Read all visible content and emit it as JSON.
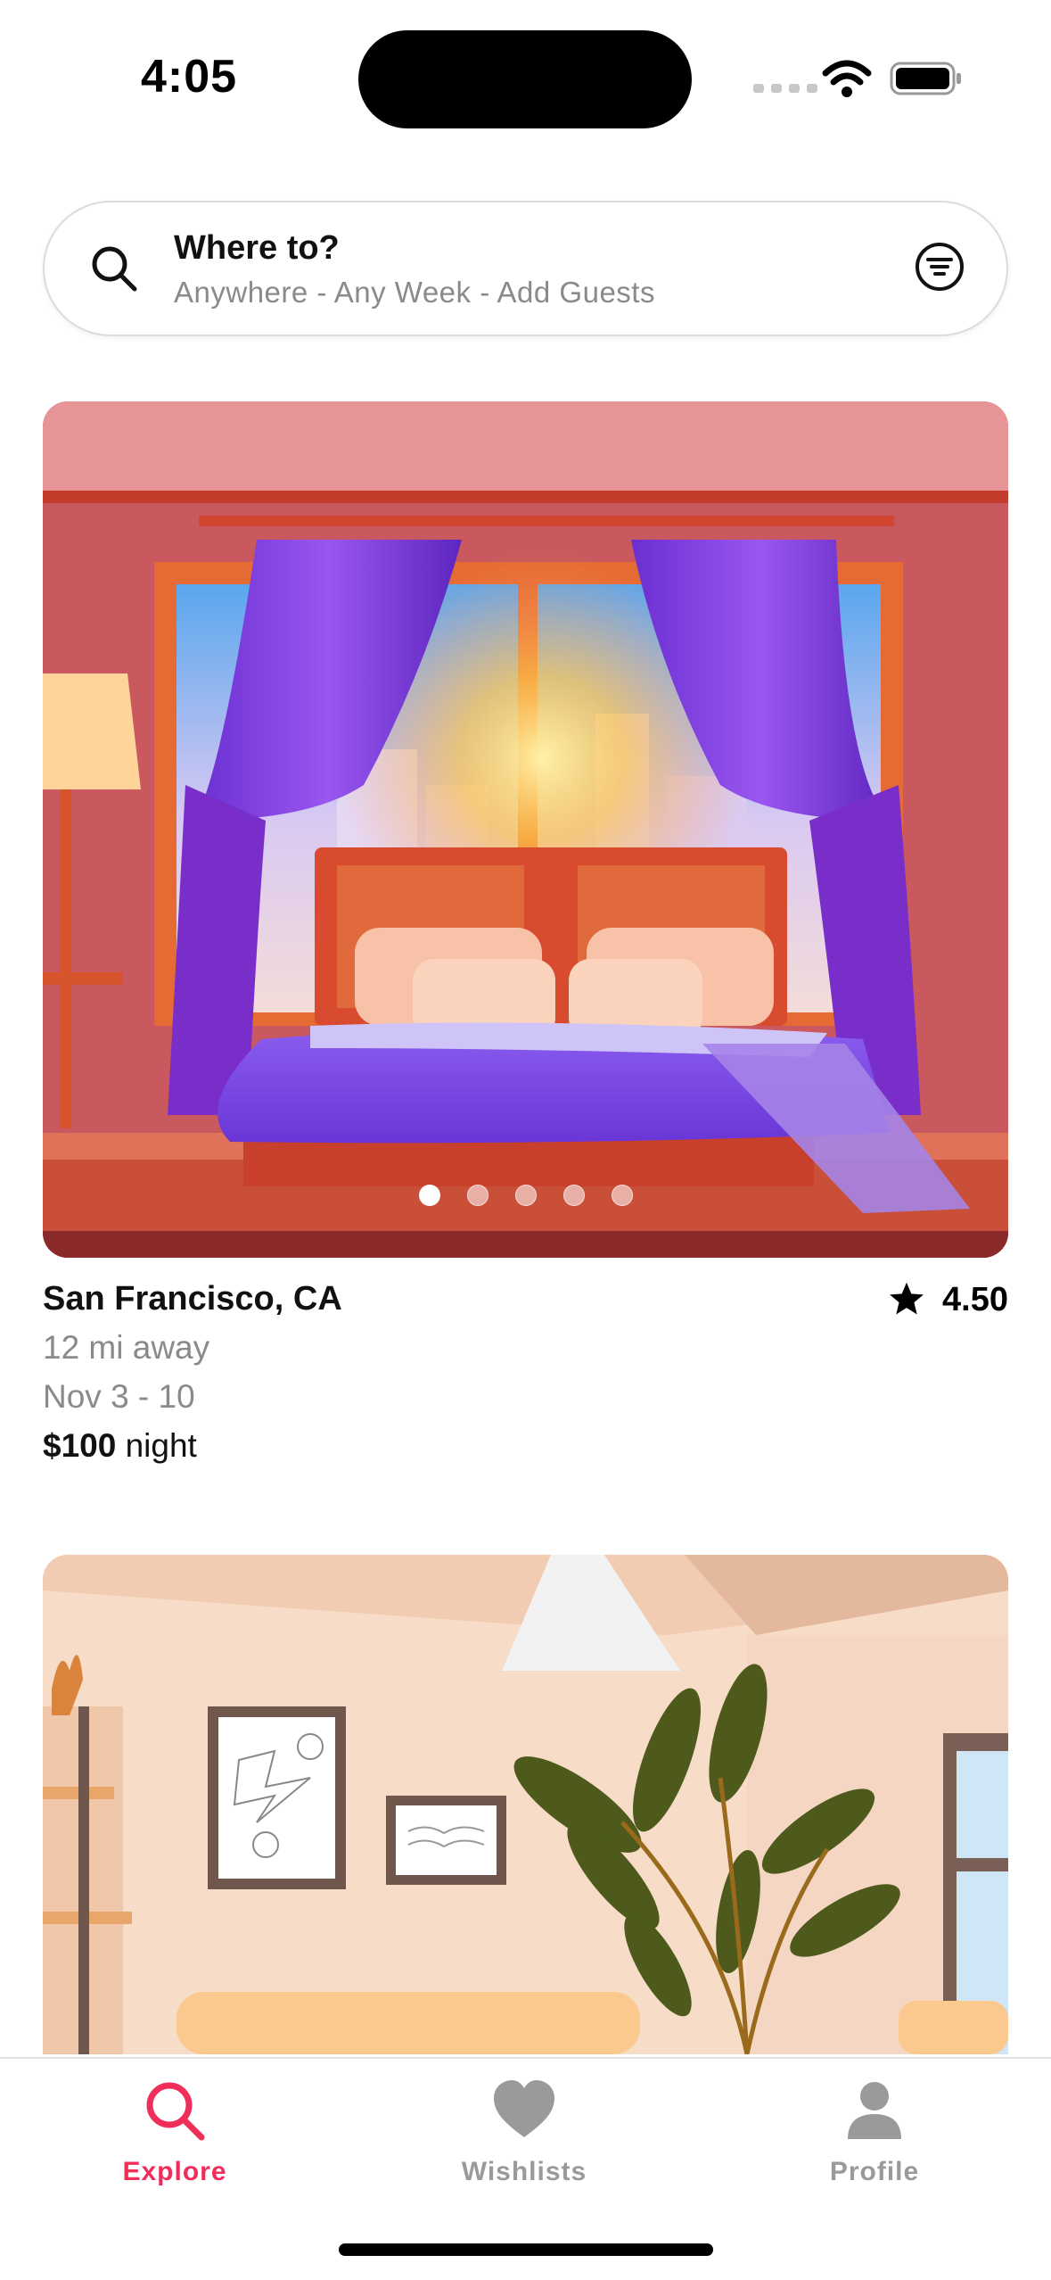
{
  "status_bar": {
    "time": "4:05"
  },
  "search": {
    "title": "Where to?",
    "subtitle": "Anywhere - Any Week - Add Guests"
  },
  "listings": [
    {
      "image": "bedroom-illustration",
      "photo_count": 5,
      "active_photo": 1,
      "location": "San Francisco, CA",
      "rating": "4.50",
      "distance": "12 mi away",
      "dates": "Nov 3 - 10",
      "price": "$100",
      "price_unit": "night"
    },
    {
      "image": "living-room-illustration"
    }
  ],
  "tab_bar": {
    "tabs": [
      {
        "label": "Explore",
        "icon": "search-icon",
        "active": true
      },
      {
        "label": "Wishlists",
        "icon": "heart-icon",
        "active": false
      },
      {
        "label": "Profile",
        "icon": "person-icon",
        "active": false
      }
    ]
  },
  "colors": {
    "accent": "#ef2f5a",
    "inactive": "#9a9a9a"
  }
}
